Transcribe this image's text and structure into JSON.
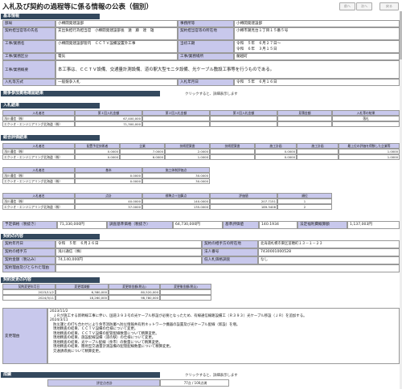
{
  "header": {
    "title": "入札及び契約の過程等に係る情報の公表（個別）",
    "btn_prev": "前へ",
    "btn_next": "次へ",
    "btn_back": "戻る"
  },
  "basic": {
    "section": "基本情報",
    "rows": [
      {
        "l1": "部局",
        "v1": "小樽開発建設部",
        "l2": "事務所等",
        "v2": "小樽開発建設部"
      },
      {
        "l1": "契約担当官等の氏名",
        "v1": "支出負担行為担当官　小樽開発建設部長　遠　藤　達　雄",
        "l2": "契約担当官等の所在地",
        "v2": "小樽市潮見台１丁目１５番５号"
      },
      {
        "l1": "工事/業務名",
        "v1": "小樽開発建設部管内　ＣＣＴＶ設備設置外工事",
        "l2": "当初工期",
        "v2": "令和　５年　６月２７日～\n令和　６年　３月１５日"
      },
      {
        "l1": "工事/業務区分",
        "v1": "電気",
        "l2": "工事/業務場所",
        "v2": "蘭越町"
      }
    ],
    "outline_label": "工事/業務概要",
    "outline_value": "本工事は、ＣＣＴＶ設備、交通量計測設備、道の駅大型モニタ設備、光ケーブル敷設工事等を行うものである。",
    "method_label": "入札等方式",
    "method_value": "一般競争入札",
    "date_label": "入札年月日",
    "date_value": "令和　５年　６月１６日"
  },
  "competition": {
    "section": "競争参加資格確認結果",
    "note": "クリックすると、詳細表示します"
  },
  "result": {
    "section": "入札結果",
    "headers": [
      "入札者名",
      "第１回入札金額",
      "第２回入札金額",
      "第３回入札金額",
      "見積金額",
      "入札等の結果"
    ],
    "rows": [
      [
        "浅川通信（株）",
        "67,400,000",
        "",
        "",
        "",
        "落札"
      ],
      [
        "エクシオ・エンジニアリング北海道（株）",
        "71,300,000",
        "",
        "",
        "",
        ""
      ]
    ]
  },
  "eval": {
    "section": "総合評価結果",
    "t1_headers": [
      "入札者名",
      "配置予定技術者",
      "企業",
      "技術提案書",
      "技術提案書",
      "施工計画",
      "施工計画",
      "最上位の評価を得数した企業等"
    ],
    "t1_rows": [
      [
        "浅川通信（株）",
        "0.0000",
        "7.0000",
        "2.0000",
        "",
        "0.0000",
        "",
        "1.0000"
      ],
      [
        "エクシオ・エンジニアリング北海道（株）",
        "0.0000",
        "6.0000",
        "1.0000",
        "",
        "0.0000",
        "",
        "1.0000"
      ]
    ],
    "t2_headers": [
      "入札者名",
      "基本",
      "施工体制評価点"
    ],
    "t2_rows": [
      [
        "浅川通信（株）",
        "0.0000",
        "30.0000"
      ],
      [
        "エクシオ・エンジニアリング北海道（株）",
        "0.0000",
        "30.0000"
      ]
    ],
    "t3_headers": [
      "入札者名",
      "点計",
      "標準点＋加算点",
      "評価値",
      "順位"
    ],
    "t3_rows": [
      [
        "浅川通信（株）",
        "40.0000",
        "140.0000",
        "207.7151",
        "1"
      ],
      [
        "エクシオ・エンジニアリング北海道（株）",
        "37.0000",
        "135.0000",
        "189.3408",
        "2"
      ]
    ],
    "price_row": [
      {
        "label": "予定価格（税抜き）",
        "value": "71,330,000円"
      },
      {
        "label": "調査基準価格（税抜き）",
        "value": "64,730,000円"
      },
      {
        "label": "基準評価値",
        "value": "140.1934"
      },
      {
        "label": "法定福利費概算額",
        "value": "1,137,003円"
      }
    ]
  },
  "contract": {
    "section": "契約の内容",
    "rows": [
      {
        "l1": "契約年月日",
        "v1": "令和　５年　６月２６日",
        "l2": "契約の相手方の所在地",
        "v2": "北海道札幌市東区苗穂町１３－１－２３"
      },
      {
        "l1": "契約の相手方",
        "v1": "浅川通信（株）",
        "l2": "法人番号",
        "v2": "7430001000528"
      },
      {
        "l1": "契約金額（税込み）",
        "v1": "74,140,000円",
        "l2": "低入札価格調査",
        "v2": "なし"
      },
      {
        "l1": "契約理由及びとられた理由",
        "v1": "",
        "l2": "",
        "v2": ""
      }
    ]
  },
  "change": {
    "section": "契約変更の内容",
    "headers": [
      "契約変更年月日",
      "変更増減額",
      "変更前金額(税込)",
      "変更後金額(税込)"
    ],
    "rows": [
      [
        "2023/11/2",
        "6,380,000",
        "80,520,000",
        ""
      ],
      [
        "2024/3/11",
        "18,260,000",
        "98,780,000",
        ""
      ]
    ],
    "reason_label": "変更理由",
    "reason_lines": [
      "2023/11/2",
      "ＪＲが施工する新幹線工事に伴い、国道３９３号の光ケーブル移設が必要となったため、有線通信線路設備工（Ｒ３９３）光ケーブル移設（ＪＲ）を追加する。",
      "2024/3/11",
      "防災課との打ち合わせにより余市消防署へ防災情報共有用ネットワーク機器の設置及び光ケーブル配線（新設）を増。",
      "現地精査の結果、ＣＣＴＶ設備の仕様について変更。",
      "現地精査の結果、ＣＣＴＶ設備の配管配線数量について精算変更。",
      "現地精査の結果、施設配線設備（道の駅）の仕様について変更。",
      "現地精査の結果、光ケーブル配線（余市）の数量について精算変更。",
      "現地精査の結果、簡易型交通量計測設備の配管配線数量について精算変更。",
      "交通誘導員について精算変更。"
    ]
  },
  "performance": {
    "section": "成績",
    "note": "クリックすると、詳細表示します",
    "header": "評定点合計",
    "value": "77点 / 100点満"
  }
}
